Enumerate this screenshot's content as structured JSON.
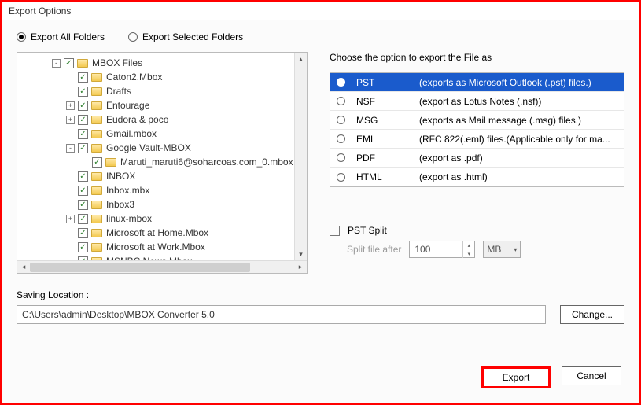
{
  "window": {
    "title": "Export Options"
  },
  "radios": {
    "all": "Export All Folders",
    "selected": "Export Selected Folders"
  },
  "tree": {
    "items": [
      {
        "indent": 1,
        "expander": "-",
        "checked": true,
        "label": "MBOX Files"
      },
      {
        "indent": 2,
        "expander": "",
        "checked": true,
        "label": "Caton2.Mbox"
      },
      {
        "indent": 2,
        "expander": "",
        "checked": true,
        "label": "Drafts"
      },
      {
        "indent": 2,
        "expander": "+",
        "checked": true,
        "label": "Entourage"
      },
      {
        "indent": 2,
        "expander": "+",
        "checked": true,
        "label": "Eudora & poco"
      },
      {
        "indent": 2,
        "expander": "",
        "checked": true,
        "label": "Gmail.mbox"
      },
      {
        "indent": 2,
        "expander": "-",
        "checked": true,
        "label": "Google Vault-MBOX"
      },
      {
        "indent": 3,
        "expander": "",
        "checked": true,
        "label": "Maruti_maruti6@soharcoas.com_0.mbox"
      },
      {
        "indent": 2,
        "expander": "",
        "checked": true,
        "label": "INBOX"
      },
      {
        "indent": 2,
        "expander": "",
        "checked": true,
        "label": "Inbox.mbx"
      },
      {
        "indent": 2,
        "expander": "",
        "checked": true,
        "label": "Inbox3"
      },
      {
        "indent": 2,
        "expander": "+",
        "checked": true,
        "label": "linux-mbox"
      },
      {
        "indent": 2,
        "expander": "",
        "checked": true,
        "label": "Microsoft at Home.Mbox"
      },
      {
        "indent": 2,
        "expander": "",
        "checked": true,
        "label": "Microsoft at Work.Mbox"
      },
      {
        "indent": 2,
        "expander": "",
        "checked": true,
        "label": "MSNBC News.Mbox"
      }
    ]
  },
  "right": {
    "choose_label": "Choose the option to export the File as",
    "options": [
      {
        "name": "PST",
        "desc": "(exports as Microsoft Outlook (.pst) files.)",
        "selected": true
      },
      {
        "name": "NSF",
        "desc": "(export as Lotus Notes (.nsf))",
        "selected": false
      },
      {
        "name": "MSG",
        "desc": "(exports as Mail message (.msg) files.)",
        "selected": false
      },
      {
        "name": "EML",
        "desc": "(RFC 822(.eml) files.(Applicable only for ma...",
        "selected": false
      },
      {
        "name": "PDF",
        "desc": "(export as .pdf)",
        "selected": false
      },
      {
        "name": "HTML",
        "desc": "(export as .html)",
        "selected": false
      }
    ],
    "pst_split_label": "PST Split",
    "split_after_label": "Split file after",
    "split_value": "100",
    "split_unit": "MB"
  },
  "save": {
    "label": "Saving Location :",
    "path": "C:\\Users\\admin\\Desktop\\MBOX Converter 5.0",
    "change": "Change..."
  },
  "footer": {
    "export": "Export",
    "cancel": "Cancel"
  }
}
